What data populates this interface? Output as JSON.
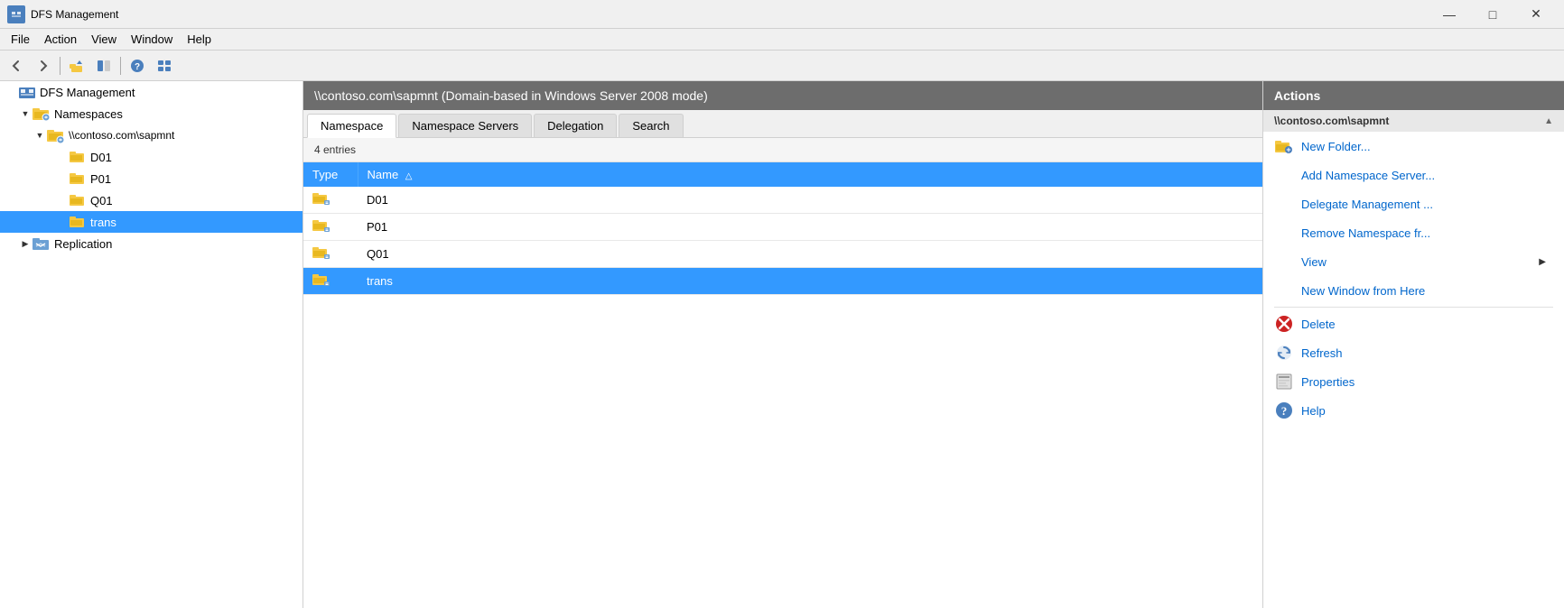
{
  "window": {
    "title": "DFS Management",
    "icon_label": "DFS"
  },
  "title_bar_controls": {
    "minimize": "—",
    "maximize": "□",
    "close": "✕"
  },
  "menu_bar": {
    "items": [
      "File",
      "Action",
      "View",
      "Window",
      "Help"
    ]
  },
  "toolbar": {
    "buttons": [
      "◀",
      "▶",
      "⬆",
      "📁",
      "?",
      "📊"
    ]
  },
  "tree": {
    "root": "DFS Management",
    "namespaces_label": "Namespaces",
    "namespace_path": "\\\\contoso.com\\sapmnt",
    "folders": [
      "D01",
      "P01",
      "Q01",
      "trans"
    ],
    "replication_label": "Replication"
  },
  "content": {
    "header": "\\\\contoso.com\\sapmnt   (Domain-based in Windows Server 2008 mode)",
    "tabs": [
      "Namespace",
      "Namespace Servers",
      "Delegation",
      "Search"
    ],
    "active_tab": "Namespace",
    "entries_count": "4 entries",
    "table": {
      "columns": [
        "Type",
        "Name"
      ],
      "rows": [
        {
          "type": "folder",
          "name": "D01",
          "selected": false
        },
        {
          "type": "folder",
          "name": "P01",
          "selected": false
        },
        {
          "type": "folder",
          "name": "Q01",
          "selected": false
        },
        {
          "type": "folder",
          "name": "trans",
          "selected": true
        }
      ]
    }
  },
  "actions": {
    "header": "Actions",
    "section_title": "\\\\contoso.com\\sapmnt",
    "items": [
      {
        "label": "New Folder...",
        "has_icon": true,
        "icon_type": "new-folder"
      },
      {
        "label": "Add Namespace Server...",
        "has_icon": false
      },
      {
        "label": "Delegate Management ...",
        "has_icon": false
      },
      {
        "label": "Remove Namespace fr...",
        "has_icon": false
      },
      {
        "label": "View",
        "has_icon": false,
        "has_submenu": true
      },
      {
        "label": "New Window from Here",
        "has_icon": false
      },
      {
        "label": "Delete",
        "has_icon": true,
        "icon_type": "delete"
      },
      {
        "label": "Refresh",
        "has_icon": true,
        "icon_type": "refresh"
      },
      {
        "label": "Properties",
        "has_icon": true,
        "icon_type": "properties"
      },
      {
        "label": "Help",
        "has_icon": true,
        "icon_type": "help"
      }
    ]
  }
}
